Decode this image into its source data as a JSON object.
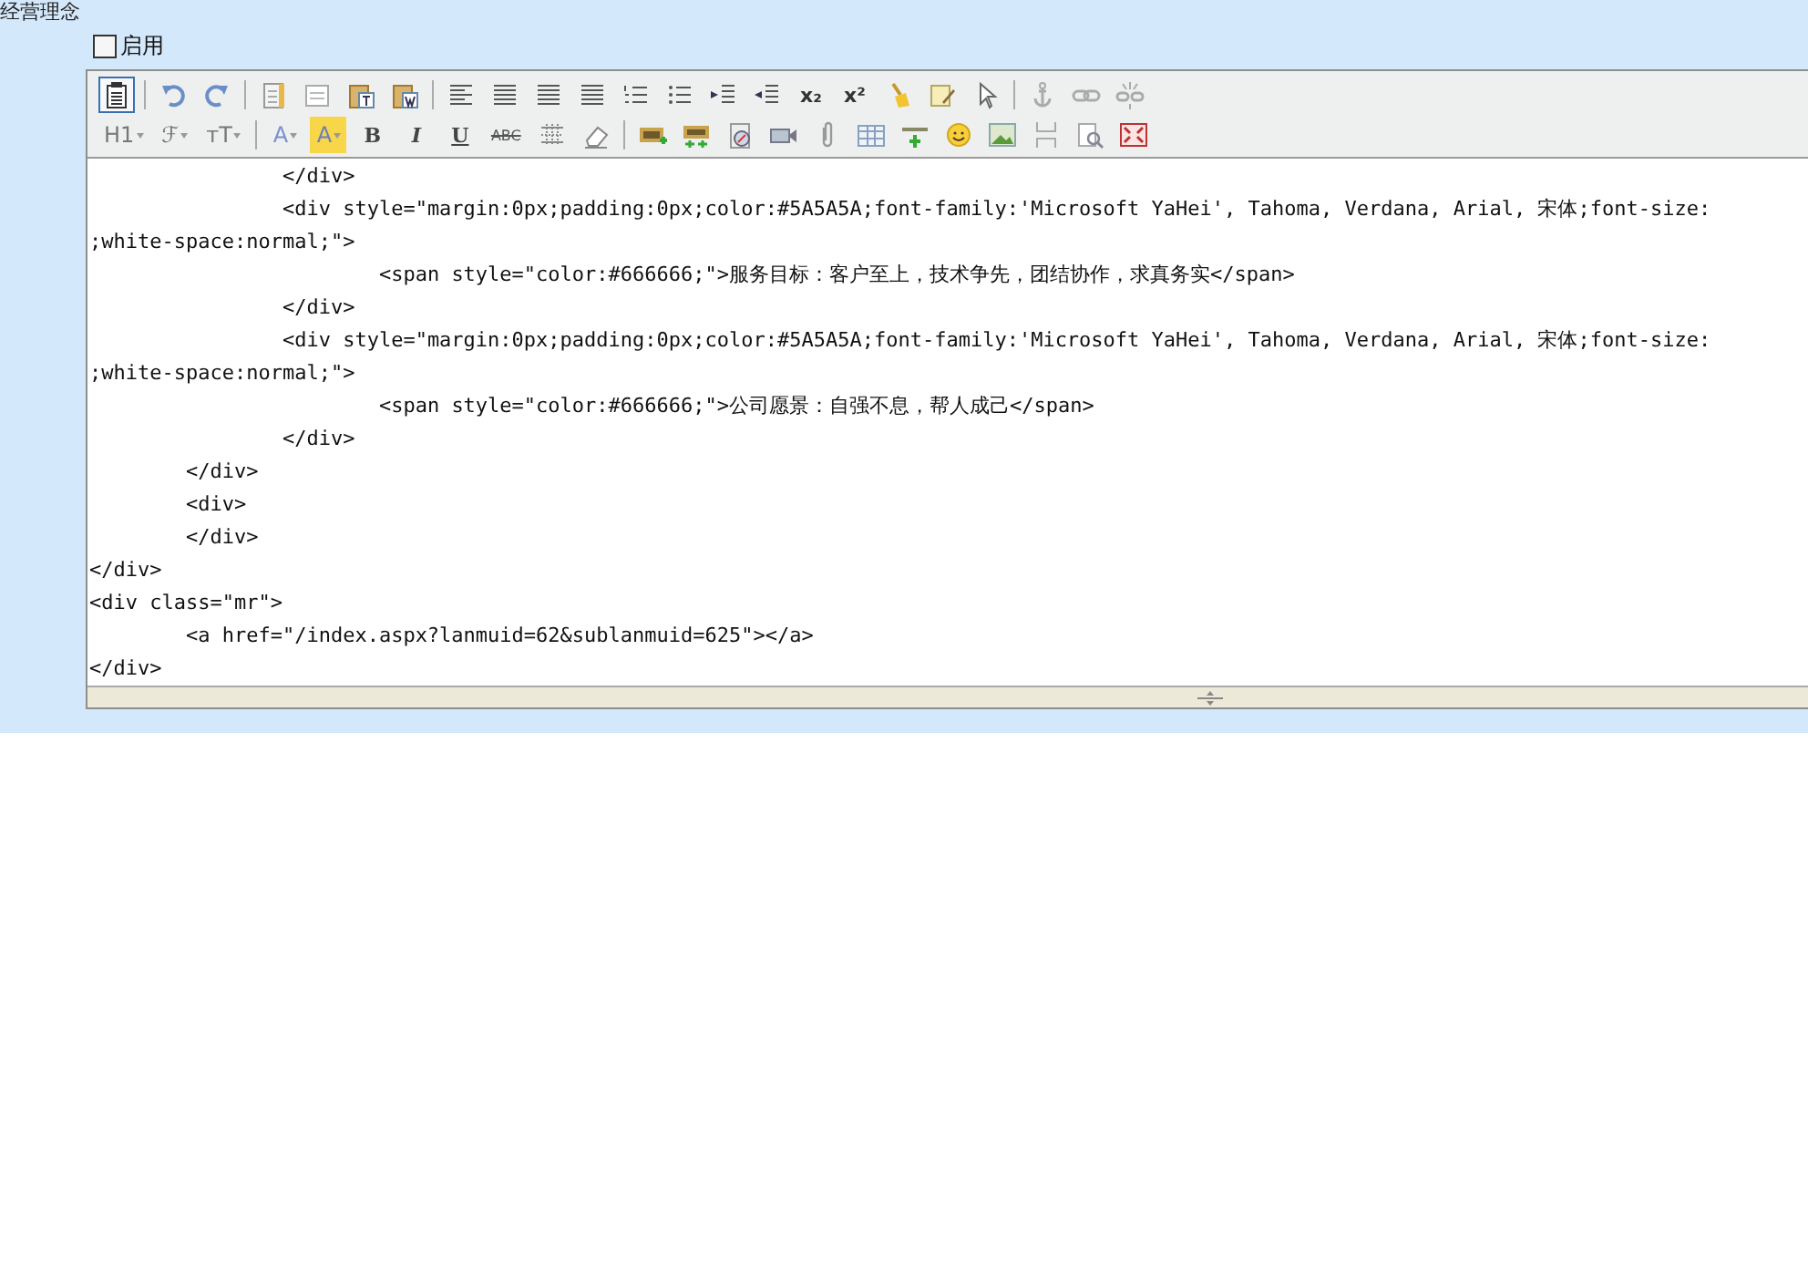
{
  "section_title": "经营理念",
  "enable_checkbox": {
    "label": "启用",
    "checked": false
  },
  "toolbar": {
    "row_1": [
      {
        "kind": "button",
        "selected": true
      },
      {
        "kind": "separator"
      },
      {
        "kind": "button",
        "selected": false
      },
      {
        "kind": "button",
        "selected": false
      },
      {
        "kind": "separator"
      },
      {
        "kind": "button",
        "selected": false
      },
      {
        "kind": "button",
        "selected": false
      },
      {
        "kind": "button",
        "selected": false
      },
      {
        "kind": "button",
        "selected": false
      },
      {
        "kind": "separator"
      },
      {
        "kind": "button",
        "selected": false
      },
      {
        "kind": "button",
        "selected": false
      },
      {
        "kind": "button",
        "selected": false
      },
      {
        "kind": "button",
        "selected": false
      },
      {
        "kind": "button",
        "selected": false
      },
      {
        "kind": "button",
        "selected": false
      },
      {
        "kind": "button",
        "selected": false
      },
      {
        "kind": "button",
        "selected": false
      },
      {
        "kind": "text",
        "label": "x₂",
        "selected": false
      },
      {
        "kind": "text",
        "label": "x²",
        "selected": false
      },
      {
        "kind": "button",
        "selected": false
      },
      {
        "kind": "button",
        "selected": false
      },
      {
        "kind": "button",
        "selected": false
      },
      {
        "kind": "separator"
      },
      {
        "kind": "button",
        "selected": false
      },
      {
        "kind": "button",
        "selected": false
      },
      {
        "kind": "button",
        "selected": false
      }
    ],
    "row_2": [
      {
        "kind": "dropdown",
        "label": "H1",
        "selected": false
      },
      {
        "kind": "dropdown",
        "label": "ℱ",
        "selected": false
      },
      {
        "kind": "dropdown",
        "label": "тT",
        "selected": false
      },
      {
        "kind": "separator"
      },
      {
        "kind": "dropdown",
        "label": "A",
        "selected": false
      },
      {
        "kind": "highlight",
        "label": "A",
        "selected": false
      },
      {
        "kind": "text",
        "label": "B",
        "selected": false
      },
      {
        "kind": "text",
        "label": "I",
        "selected": false
      },
      {
        "kind": "text",
        "label": "U",
        "selected": false
      },
      {
        "kind": "text",
        "label": "ABC",
        "selected": false
      },
      {
        "kind": "button",
        "selected": false
      },
      {
        "kind": "button",
        "selected": false
      },
      {
        "kind": "separator"
      },
      {
        "kind": "button",
        "selected": false
      },
      {
        "kind": "button",
        "selected": false
      },
      {
        "kind": "button",
        "selected": false
      },
      {
        "kind": "button",
        "selected": false
      },
      {
        "kind": "button",
        "selected": false
      },
      {
        "kind": "button",
        "selected": false
      },
      {
        "kind": "button",
        "selected": false
      },
      {
        "kind": "button",
        "selected": false
      },
      {
        "kind": "button",
        "selected": false
      },
      {
        "kind": "button",
        "selected": false
      },
      {
        "kind": "button",
        "selected": false
      },
      {
        "kind": "button",
        "selected": false
      }
    ]
  },
  "source_lines": [
    "\t\t</div>",
    "\t\t<div style=\"margin:0px;padding:0px;color:#5A5A5A;font-family:'Microsoft YaHei', Tahoma, Verdana, Arial, 宋体;font-size:",
    ";white-space:normal;\">",
    "\t\t\t<span style=\"color:#666666;\">服务目标：客户至上，技术争先，团结协作，求真务实</span>",
    "\t\t</div>",
    "\t\t<div style=\"margin:0px;padding:0px;color:#5A5A5A;font-family:'Microsoft YaHei', Tahoma, Verdana, Arial, 宋体;font-size:",
    ";white-space:normal;\">",
    "\t\t\t<span style=\"color:#666666;\">公司愿景：自强不息，帮人成己</span>",
    "\t\t</div>",
    "\t</div>",
    "\t<div>",
    "\t</div>",
    "</div>",
    "<div class=\"mr\">",
    "\t<a href=\"/index.aspx?lanmuid=62&sublanmuid=625\"></a>",
    "</div>"
  ]
}
